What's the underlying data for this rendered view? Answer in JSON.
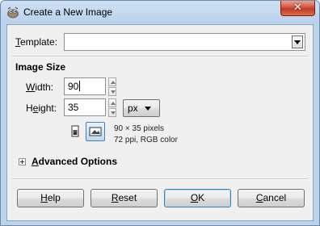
{
  "window": {
    "title": "Create a New Image"
  },
  "template": {
    "label_prefix": "",
    "label_mnemonic": "T",
    "label_rest": "emplate:",
    "value": ""
  },
  "image_size": {
    "heading": "Image Size",
    "width": {
      "label_mnemonic": "W",
      "label_rest": "idth:",
      "value": "90"
    },
    "height": {
      "label_prefix": "H",
      "label_mnemonic": "e",
      "label_rest": "ight:",
      "value": "35"
    },
    "unit": "px",
    "info_line1": "90 × 35 pixels",
    "info_line2": "72 ppi, RGB color"
  },
  "advanced": {
    "label_mnemonic": "A",
    "label_rest": "dvanced Options"
  },
  "buttons": {
    "help": {
      "mnemonic": "H",
      "rest": "elp"
    },
    "reset": {
      "mnemonic": "R",
      "rest": "eset"
    },
    "ok": {
      "mnemonic": "O",
      "rest": "K"
    },
    "cancel": {
      "mnemonic": "C",
      "rest": "ancel"
    }
  },
  "colors": {
    "title_bar": "#bcd3ec",
    "close_button": "#c13a24",
    "dialog_bg": "#f0f0f0",
    "default_button_border": "#3c7fb1"
  }
}
